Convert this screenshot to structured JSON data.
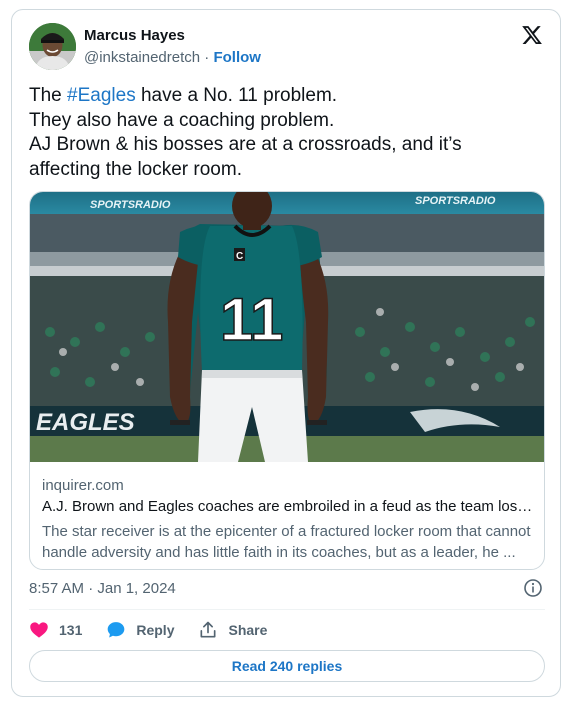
{
  "author": {
    "name": "Marcus Hayes",
    "handle": "@inkstainedretch",
    "separator": "·",
    "follow_label": "Follow"
  },
  "tweet": {
    "lines": [
      {
        "prefix": "The ",
        "hashtag": "#Eagles",
        "suffix": " have a No. 11 problem."
      },
      {
        "text": "They also have a coaching problem."
      },
      {
        "text": "AJ Brown & his bosses are at a crossroads, and it’s"
      },
      {
        "text": "affecting the locker room."
      }
    ]
  },
  "link_card": {
    "domain": "inquirer.com",
    "title": "A.J. Brown and Eagles coaches are embroiled in a feud as the team loses...",
    "description": "The star receiver is at the epicenter of a fractured locker room that cannot handle adversity and has little faith in its coaches, but as a leader, he ...",
    "image": {
      "jersey_number": "11",
      "captain_patch": "C",
      "banner_text": "SPORTSRADIO",
      "wall_text": "EAGLES"
    }
  },
  "meta": {
    "timestamp": "8:57 AM · Jan 1, 2024"
  },
  "actions": {
    "likes_count": "131",
    "reply_label": "Reply",
    "share_label": "Share"
  },
  "read_replies_label": "Read 240 replies",
  "colors": {
    "link_blue": "#1d76c6",
    "like_pink": "#f91880",
    "secondary_text": "#536471",
    "border": "#cfd9de"
  },
  "icons": [
    "x-logo-icon",
    "info-icon",
    "heart-icon",
    "speech-bubble-icon",
    "share-icon"
  ]
}
